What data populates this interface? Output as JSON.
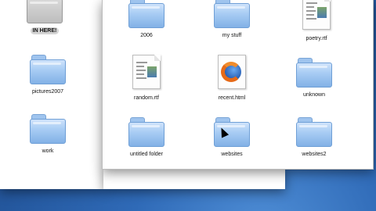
{
  "back_window": {
    "items": [
      {
        "label": "IN HERE!",
        "icon": "folder-icon",
        "selected": true
      },
      {
        "label": "pictures2007",
        "icon": "folder-icon"
      },
      {
        "label": "work",
        "icon": "folder-icon"
      }
    ]
  },
  "front_window": {
    "items": [
      {
        "label": "2006",
        "icon": "folder-icon"
      },
      {
        "label": "my stuff",
        "icon": "folder-icon"
      },
      {
        "label": "poetry.rtf",
        "icon": "rtf-document-icon"
      },
      {
        "label": "random.rtf",
        "icon": "rtf-document-icon"
      },
      {
        "label": "recent.html",
        "icon": "firefox-html-icon"
      },
      {
        "label": "unknown",
        "icon": "folder-icon"
      },
      {
        "label": "untitled folder",
        "icon": "folder-icon"
      },
      {
        "label": "websites",
        "icon": "folder-icon"
      },
      {
        "label": "websites2",
        "icon": "folder-icon"
      }
    ]
  },
  "colors": {
    "desktop": "#2f6ab7",
    "folder_blue": "#a9cdf4",
    "selection": "#d4d4d4"
  }
}
